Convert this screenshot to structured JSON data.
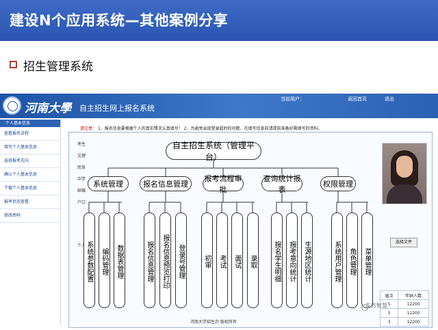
{
  "slide": {
    "title": "建设N个应用系统—其他案例分享",
    "subtitle": "招生管理系统"
  },
  "portal": {
    "logo_text": "河南大學",
    "system_title": "自主招生网上报名系统",
    "top_links": [
      "当前用户：",
      "返回首页",
      "退出"
    ],
    "sidebar_header": "个人基本信息",
    "sidebar_items": [
      "查看报名流程",
      "填写个人基本信息",
      "选择报考志向",
      "确认个人基本信息",
      "下载个人基本信息",
      "报考状态查看",
      "修改密码"
    ],
    "tip_prefix": "请注意：",
    "tip_text": "1、报名信息要根据个人的真实情况认真填写！ 2、为避免出现登录超时的问题，在填写信息前请提前准备好需填写的资料。",
    "form_labels": [
      "考生",
      "文理",
      "民族",
      "中学",
      "邮箱",
      "户口",
      "个人"
    ],
    "upload_button": "选择文件",
    "score_table": {
      "headers": [
        "届次",
        "年纳人数"
      ],
      "rows": [
        [
          "5",
          "12200"
        ],
        [
          "5",
          "12200"
        ],
        [
          "3",
          "12200"
        ]
      ]
    },
    "footer": "河南大学招生办  版权所有"
  },
  "diagram": {
    "root": "自主招生系统（管理平台）",
    "modules": [
      {
        "label": "系统管理",
        "items": [
          "系统参数配置",
          "编码管理",
          "数据表管理"
        ]
      },
      {
        "label": "报名信息管理",
        "items": [
          "报名信息管理",
          "报名信息预览打印",
          "登录号管理"
        ]
      },
      {
        "label": "报考流程审批",
        "items": [
          "初审",
          "考试",
          "面试",
          "录取"
        ]
      },
      {
        "label": "查询统计报表",
        "items": [
          "报名学生明细",
          "报考意向统计",
          "生源地区统计"
        ]
      },
      {
        "label": "权限管理",
        "items": [
          "系统用户管理",
          "角色管理",
          "菜单管理"
        ]
      }
    ]
  },
  "watermark": "东方智慧"
}
